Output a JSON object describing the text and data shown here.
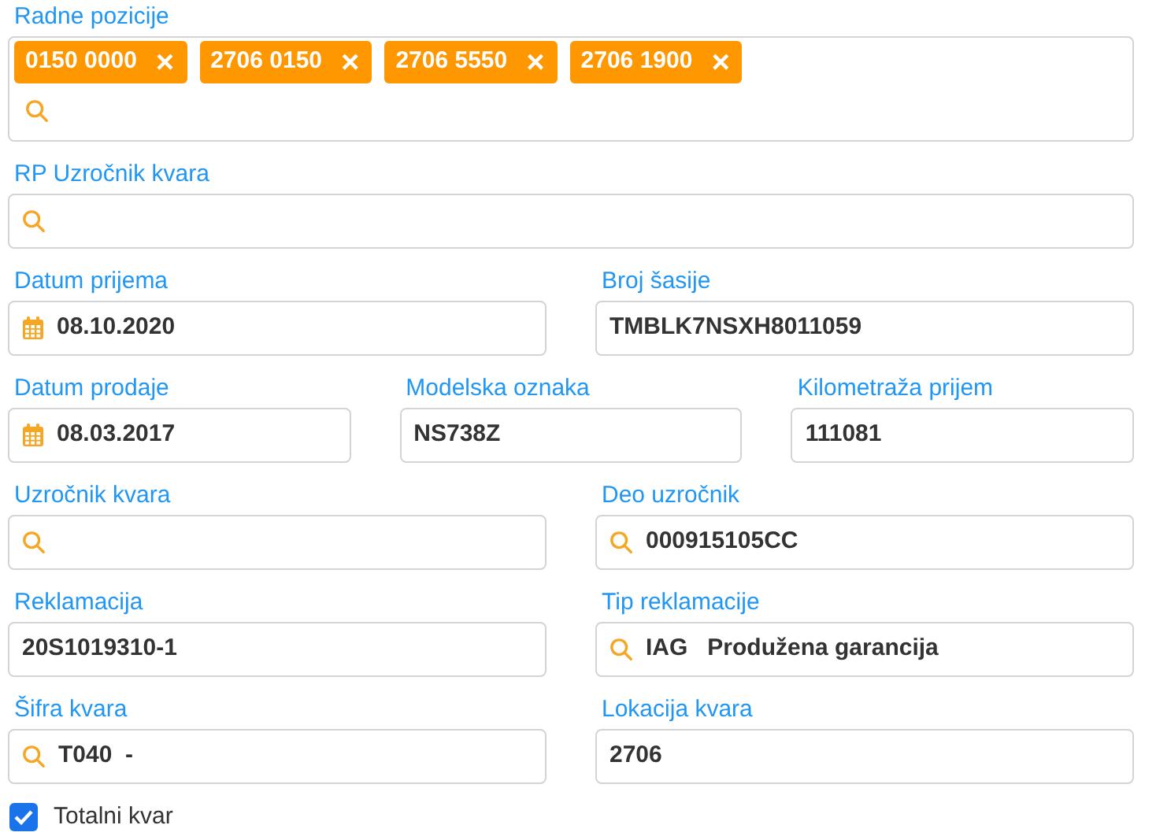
{
  "work_positions": {
    "label": "Radne pozicije",
    "tags": [
      {
        "text": "0150 0000",
        "remove": "×"
      },
      {
        "text": "2706 0150",
        "remove": "×"
      },
      {
        "text": "2706 5550",
        "remove": "×"
      },
      {
        "text": "2706 1900",
        "remove": "×"
      }
    ]
  },
  "rows": [
    {
      "fields": [
        {
          "label": "RP Uzročnik kvara",
          "kind": "search"
        }
      ]
    },
    {
      "fields": [
        {
          "label": "Datum prijema",
          "kind": "calendar",
          "value": "08.10.2020"
        },
        {
          "label": "Broj šasije",
          "kind": "plain",
          "value": "TMBLK7NSXH8011059"
        }
      ]
    },
    {
      "fields": [
        {
          "label": "Datum prodaje",
          "kind": "calendar",
          "value": "08.03.2017"
        },
        {
          "label": "Modelska oznaka",
          "kind": "plain",
          "value": "NS738Z"
        },
        {
          "label": "Kilometraža prijem",
          "kind": "plain",
          "value": "111081"
        }
      ]
    },
    {
      "fields": [
        {
          "label": "Uzročnik kvara",
          "kind": "search"
        },
        {
          "label": "Deo uzročnik",
          "kind": "search",
          "value": "000915105CC"
        }
      ]
    },
    {
      "fields": [
        {
          "label": "Reklamacija",
          "kind": "plain",
          "value": "20S1019310-1"
        },
        {
          "label": "Tip reklamacije",
          "kind": "search",
          "value": "IAG   Produžena garancija"
        }
      ]
    },
    {
      "fields": [
        {
          "label": "Šifra kvara",
          "kind": "search",
          "value": "T040  -"
        },
        {
          "label": "Lokacija kvara",
          "kind": "plain",
          "value": "2706"
        }
      ]
    }
  ],
  "checkbox": {
    "label": "Totalni kvar",
    "checked": true
  }
}
